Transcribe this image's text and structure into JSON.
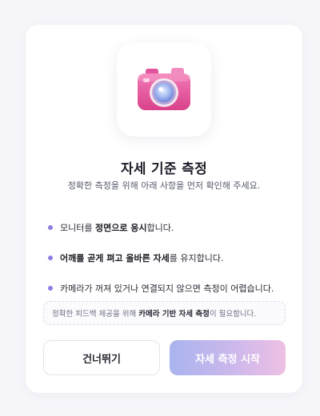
{
  "dialog": {
    "title": "자세 기준 측정",
    "subtitle": "정확한 측정을 위해 아래 사항을 먼저 확인해 주세요."
  },
  "tips": [
    {
      "pre": "모니터를 ",
      "bold": "정면으로 응시",
      "post": "합니다."
    },
    {
      "pre": "",
      "bold": "어깨를 곧게 펴고 올바른 자세",
      "post": "를 유지합니다."
    },
    {
      "pre": "카메라가 꺼져 있거나 연결되지 않으면 측정이 어렵습니다.",
      "bold": "",
      "post": ""
    }
  ],
  "notice": {
    "pre": "정확한 피드백 제공을 위해 ",
    "bold": "카메라 기반 자세 측정",
    "post": "이 필요합니다."
  },
  "buttons": {
    "skip_label": "건너뛰기",
    "start_label": "자세 측정 시작"
  },
  "icons": {
    "header": "camera-icon"
  },
  "colors": {
    "bullet": "#8f7be0",
    "camera_body": "#e8559a",
    "start_gradient": [
      "#a9b4ee",
      "#eec0e4"
    ]
  }
}
